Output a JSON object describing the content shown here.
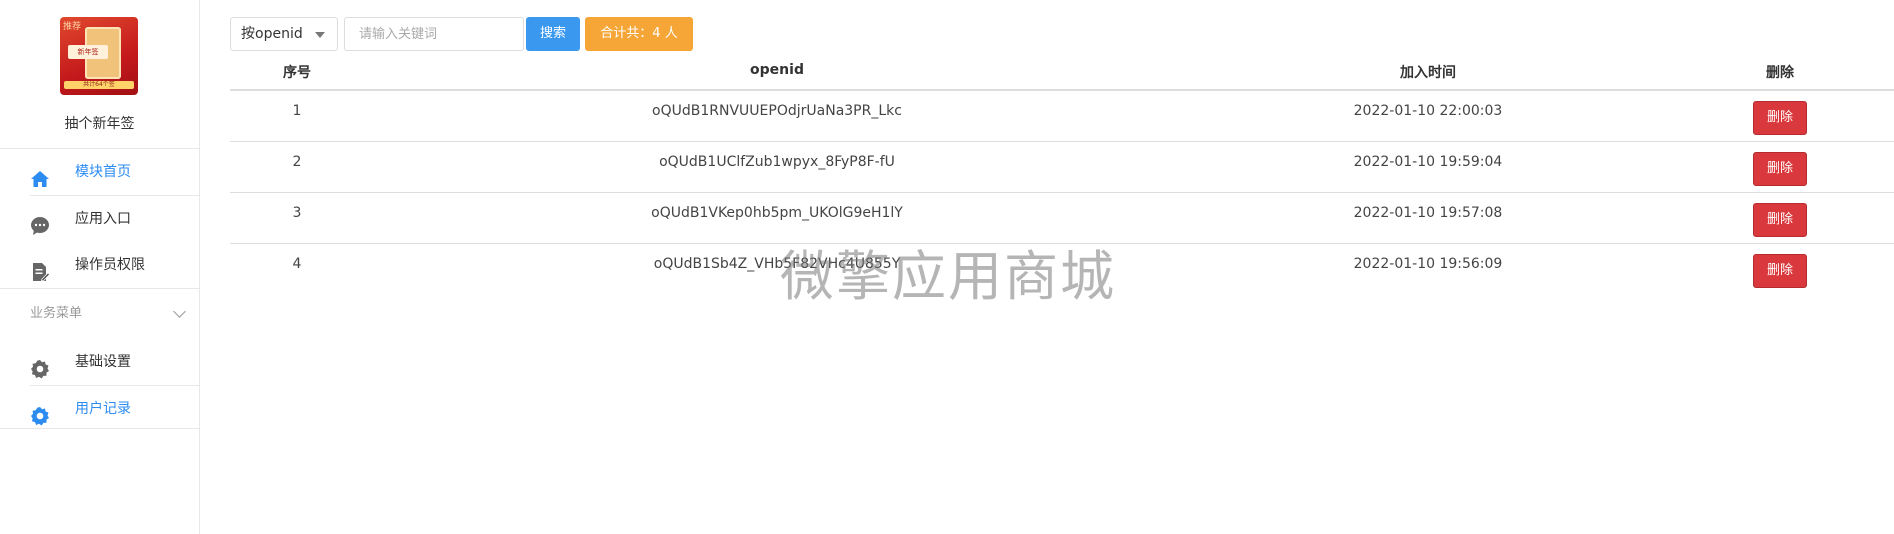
{
  "app": {
    "name": "抽个新年签",
    "logo_caption": "推荐",
    "logo_tag": "新年签",
    "logo_bar": "共计64个签"
  },
  "sidebar": {
    "items": [
      {
        "label": "模块首页",
        "icon": "home-icon",
        "active": true
      },
      {
        "label": "应用入口",
        "icon": "chat-icon",
        "active": false
      },
      {
        "label": "操作员权限",
        "icon": "document-edit-icon",
        "active": false
      }
    ],
    "group": {
      "label": "业务菜单",
      "items": [
        {
          "label": "基础设置",
          "icon": "gear-icon",
          "active": false
        },
        {
          "label": "用户记录",
          "icon": "gear-icon",
          "active": true
        }
      ]
    }
  },
  "toolbar": {
    "filter_value": "按openid",
    "search_placeholder": "请输入关键词",
    "search_label": "搜索",
    "total_label": "合计共：4 人"
  },
  "table": {
    "headers": [
      "序号",
      "openid",
      "加入时间",
      "删除"
    ],
    "rows": [
      {
        "no": "1",
        "openid": "oQUdB1RNVUUEPOdjrUaNa3PR_Lkc",
        "time": "2022-01-10 22:00:03",
        "action": "删除"
      },
      {
        "no": "2",
        "openid": "oQUdB1UClfZub1wpyx_8FyP8F-fU",
        "time": "2022-01-10 19:59:04",
        "action": "删除"
      },
      {
        "no": "3",
        "openid": "oQUdB1VKep0hb5pm_UKOlG9eH1lY",
        "time": "2022-01-10 19:57:08",
        "action": "删除"
      },
      {
        "no": "4",
        "openid": "oQUdB1Sb4Z_VHb5F82VHc4U855Y",
        "time": "2022-01-10 19:56:09",
        "action": "删除"
      }
    ]
  },
  "watermark": "微擎应用商城",
  "colors": {
    "accent": "#2d8cf0",
    "search_button": "#3a98ef",
    "total_button": "#f5a637",
    "delete_button": "#d9393c",
    "icon_gray": "#666666"
  }
}
